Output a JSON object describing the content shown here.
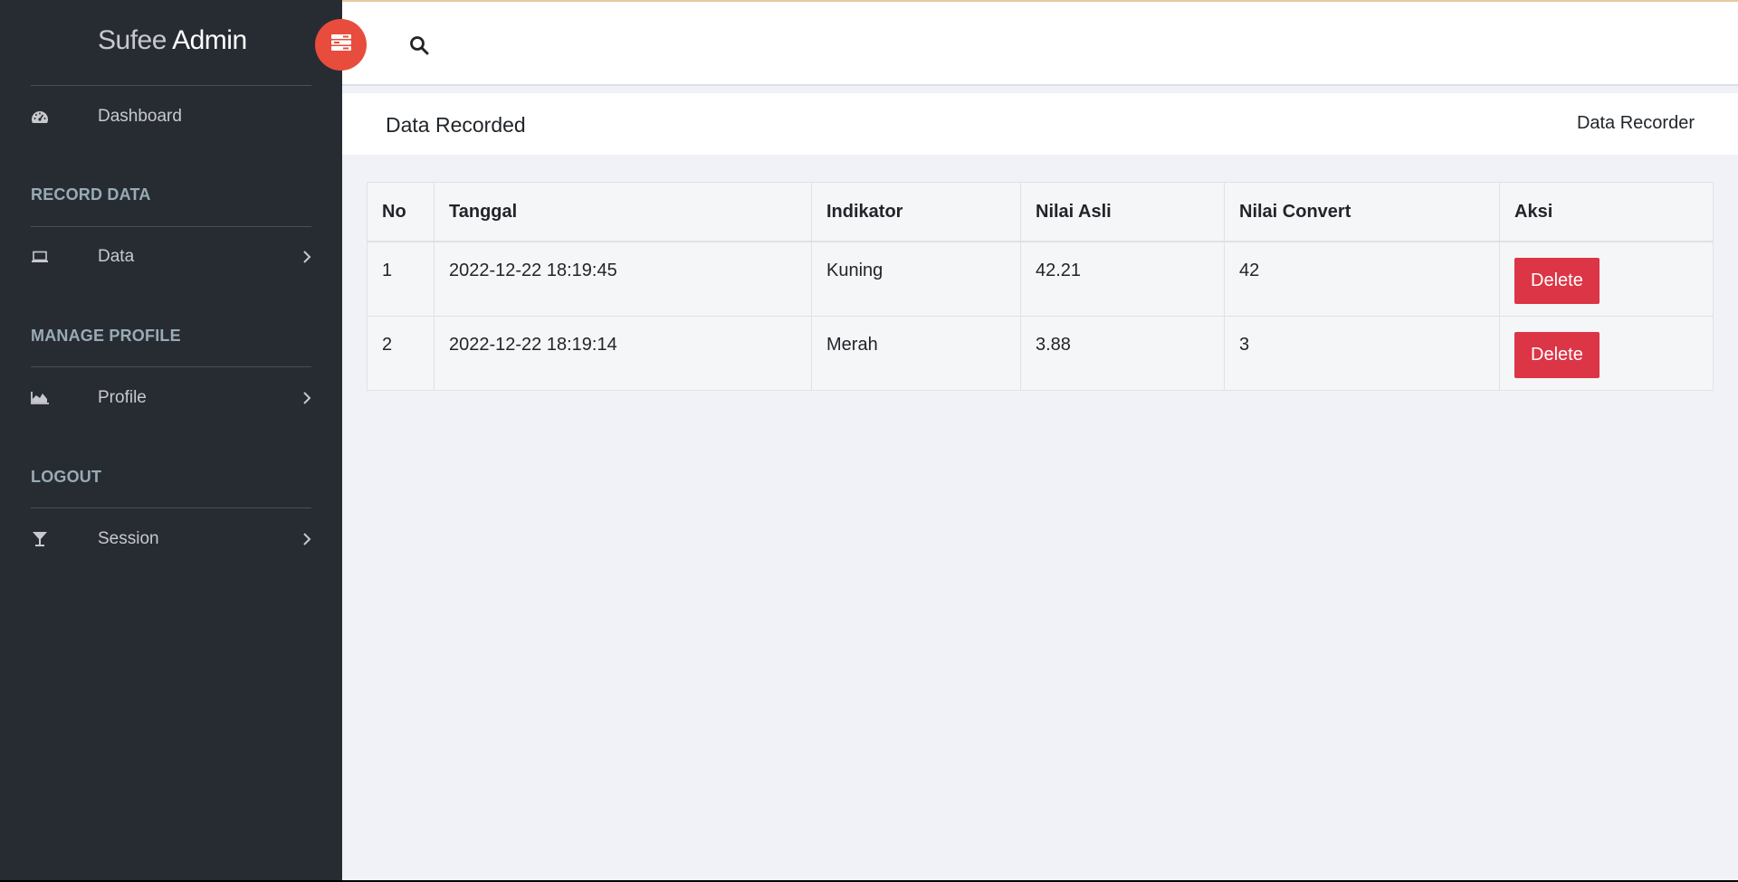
{
  "sidebar": {
    "brand_light": "Sufee",
    "brand_bold": "Admin",
    "dashboard_label": "Dashboard",
    "sections": [
      {
        "title": "RECORD DATA",
        "item": "Data"
      },
      {
        "title": "MANAGE PROFILE",
        "item": "Profile"
      },
      {
        "title": "LOGOUT",
        "item": "Session"
      }
    ]
  },
  "header": {
    "page_title": "Data Recorded",
    "breadcrumb": "Data Recorder"
  },
  "table": {
    "headers": [
      "No",
      "Tanggal",
      "Indikator",
      "Nilai Asli",
      "Nilai Convert",
      "Aksi"
    ],
    "rows": [
      {
        "no": "1",
        "tanggal": "2022-12-22 18:19:45",
        "indikator": "Kuning",
        "asli": "42.21",
        "convert": "42",
        "action": "Delete"
      },
      {
        "no": "2",
        "tanggal": "2022-12-22 18:19:14",
        "indikator": "Merah",
        "asli": "3.88",
        "convert": "3",
        "action": "Delete"
      }
    ]
  },
  "colors": {
    "sidebar_bg": "#272c33",
    "accent_red": "#e74c3c",
    "danger": "#dc3545",
    "content_bg": "#f1f2f7"
  },
  "icons": {
    "dashboard": "dashboard-icon",
    "data": "laptop-icon",
    "profile": "area-chart-icon",
    "session": "glass-icon",
    "toggle": "menu-toggle-icon",
    "search": "search-icon"
  }
}
